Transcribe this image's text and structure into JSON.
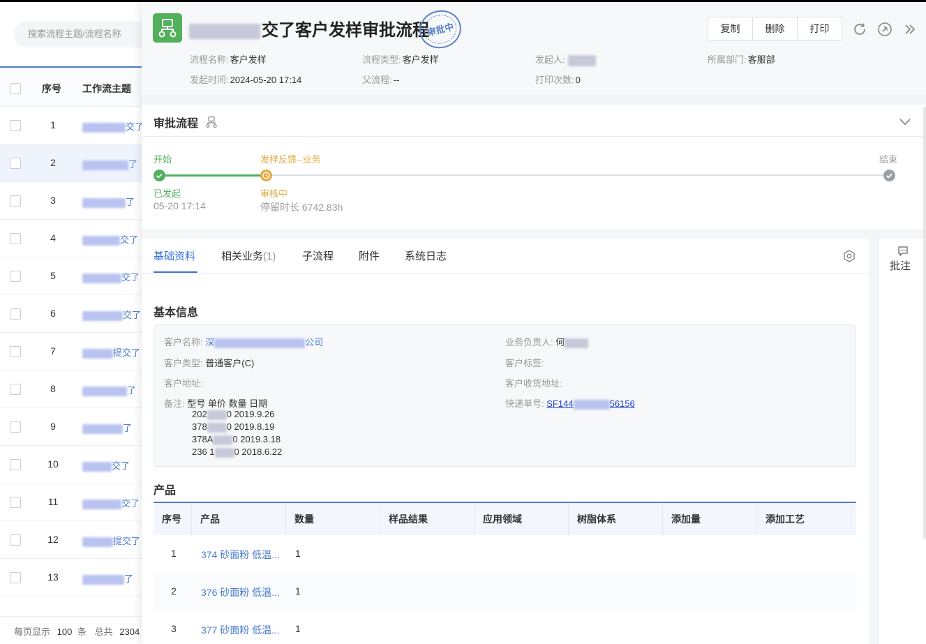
{
  "left_panel": {
    "search_placeholder": "搜索流程主题/流程名称",
    "columns": {
      "no": "序号",
      "subject": "工作流主题"
    },
    "rows": [
      {
        "no": "1",
        "subject_tail": "交了"
      },
      {
        "no": "2",
        "subject_tail": "了"
      },
      {
        "no": "3",
        "subject_tail": "了"
      },
      {
        "no": "4",
        "subject_tail": "交了"
      },
      {
        "no": "5",
        "subject_tail": "交了"
      },
      {
        "no": "6",
        "subject_tail": "交了"
      },
      {
        "no": "7",
        "subject_tail": "提交了"
      },
      {
        "no": "8",
        "subject_tail": "了"
      },
      {
        "no": "9",
        "subject_tail": "了"
      },
      {
        "no": "10",
        "subject_tail": "交了"
      },
      {
        "no": "11",
        "subject_tail": "交了"
      },
      {
        "no": "12",
        "subject_tail": "提交了"
      },
      {
        "no": "13",
        "subject_tail": "了"
      }
    ],
    "pager": {
      "per_page_label": "每页显示",
      "per_page": "100",
      "unit": "条",
      "total_label": "总共",
      "total": "2304"
    }
  },
  "header": {
    "title": "交了客户发样审批流程",
    "stamp_text": "审批中",
    "buttons": {
      "copy": "复制",
      "delete": "删除",
      "print": "打印"
    },
    "meta": {
      "flow_name_label": "流程名称:",
      "flow_name": "客户发样",
      "flow_type_label": "流程类型:",
      "flow_type": "客户发样",
      "initiator_label": "发起人:",
      "dept_label": "所属部门:",
      "dept": "客服部",
      "start_time_label": "发起时间:",
      "start_time": "2024-05-20 17:14",
      "parent_label": "父流程:",
      "parent": "--",
      "print_count_label": "打印次数:",
      "print_count": "0"
    }
  },
  "approval": {
    "title": "审批流程",
    "start": {
      "name": "开始",
      "status": "已发起",
      "time": "05-20 17:14"
    },
    "current": {
      "name": "发样反馈--业务",
      "status": "审核中",
      "duration": "停留时长 6742.83h"
    },
    "end": {
      "name": "结束"
    }
  },
  "tabs": [
    {
      "label": "基础资料"
    },
    {
      "label": "相关业务",
      "count": "(1)"
    },
    {
      "label": "子流程"
    },
    {
      "label": "附件"
    },
    {
      "label": "系统日志"
    }
  ],
  "basic_info": {
    "title": "基本信息",
    "customer_name_label": "客户名称:",
    "customer_name_head": "深",
    "customer_name_tail": "公司",
    "owner_label": "业务负责人:",
    "owner_head": "何",
    "customer_type_label": "客户类型:",
    "customer_type": "普通客户(C)",
    "customer_tag_label": "客户标签:",
    "address_label": "客户地址:",
    "ship_address_label": "客户收货地址:",
    "remark_label": "备注:",
    "remark_header": "型号 单价 数量 日期",
    "remark_lines": [
      {
        "head": "202",
        "tail": "0 2019.9.26"
      },
      {
        "head": "378",
        "tail": "0 2019.8.19"
      },
      {
        "head": "378A",
        "tail": "0 2019.3.18"
      },
      {
        "head": "236 1",
        "tail": "0 2018.6.22"
      }
    ],
    "express_label": "快递单号:",
    "express_head": "SF144",
    "express_tail": "56156"
  },
  "products": {
    "title": "产品",
    "columns": [
      "序号",
      "产品",
      "数量",
      "样品结果",
      "应用领域",
      "树脂体系",
      "添加量",
      "添加工艺"
    ],
    "rows": [
      {
        "no": "1",
        "product": "374 砂面粉 低温...",
        "qty": "1"
      },
      {
        "no": "2",
        "product": "376 砂面粉 低温...",
        "qty": "1"
      },
      {
        "no": "3",
        "product": "377 砂面粉 低温...",
        "qty": "1"
      }
    ]
  },
  "rail": {
    "comment_label": "批注"
  },
  "colors": {
    "accent": "#3a73d9",
    "done": "#52b05c",
    "current": "#e3a93c",
    "pending": "#9aa0a6"
  }
}
